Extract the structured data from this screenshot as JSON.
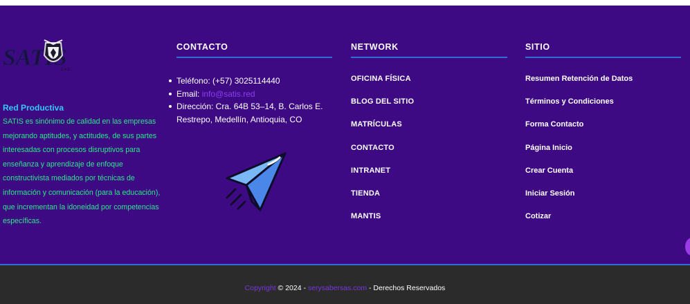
{
  "brand": {
    "title": "Red Productiva",
    "description": "SATIS es sinónimo de calidad en las empresas mejorando aptitudes, y actitudes, de sus partes interesadas con procesos disruptivos para enseñanza y aprendizaje de enfoque constructivista mediados por técnicas de información y comunicación (para la educación), que incrementan la idoneidad por competencias específicas."
  },
  "contact": {
    "heading": "CONTACTO",
    "phone": "Teléfono: (+57) 3025114440",
    "email_label": "Email: ",
    "email_value": "info@satis.red",
    "address": "Dirección: Cra. 64B 53–14, B. Carlos E. Restrepo, Medellín, Antioquia, CO"
  },
  "network": {
    "heading": "NETWORK",
    "items": [
      {
        "label": "OFICINA FÍSICA"
      },
      {
        "label": "BLOG DEL SITIO"
      },
      {
        "label": "MATRÍCULAS"
      },
      {
        "label": "CONTACTO"
      },
      {
        "label": "INTRANET"
      },
      {
        "label": "TIENDA"
      },
      {
        "label": "MANTIS"
      }
    ]
  },
  "site": {
    "heading": "SITIO",
    "items": [
      {
        "label": "Resumen Retención de Datos"
      },
      {
        "label": "Términos y Condiciones"
      },
      {
        "label": "Forma Contacto"
      },
      {
        "label": "Página Inicio"
      },
      {
        "label": "Crear Cuenta"
      },
      {
        "label": "Iniciar Sesión"
      },
      {
        "label": "Cotizar"
      }
    ]
  },
  "footer": {
    "copyright_label": "Copyright",
    "year_text": " © 2024 - ",
    "site_name": "serysabersas.com",
    "rights": " - Derechos Reservados"
  },
  "icons": {
    "logo": "satis-logo",
    "plane": "paper-plane-icon",
    "chat": "chat-bubble-icon"
  },
  "colors": {
    "background": "#3d0a84",
    "accent_blue": "#2f6fd6",
    "brand_title": "#37c8f5",
    "brand_text": "#2fe88a",
    "link_purple": "#8a3ff0",
    "bottom_bar": "#2b2b2b"
  }
}
